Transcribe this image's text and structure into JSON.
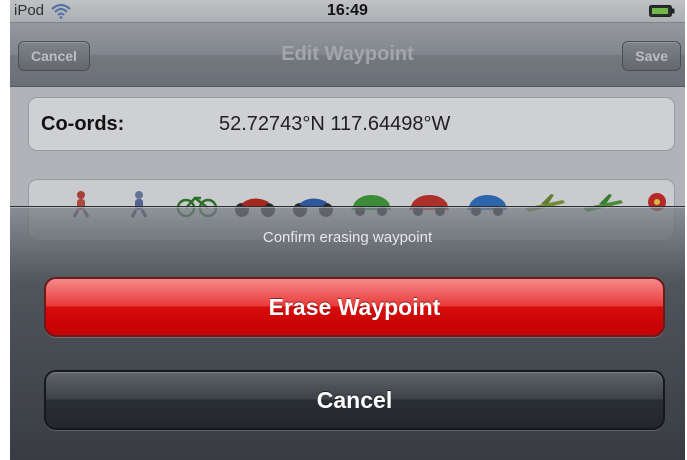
{
  "status_bar": {
    "carrier": "iPod",
    "time": "16:49",
    "wifi_icon": "wifi-icon",
    "battery_icon": "battery-icon"
  },
  "nav_bar": {
    "title": "Edit Waypoint",
    "cancel_label": "Cancel",
    "save_label": "Save"
  },
  "coords": {
    "label": "Co-ords:",
    "value": "52.72743°N 117.64498°W"
  },
  "icon_row": {
    "icons": [
      "walker-icon",
      "hiker-icon",
      "bicycle-icon",
      "motorcycle-red-icon",
      "motorcycle-blue-icon",
      "car-green-icon",
      "car-red-icon",
      "car-blue-icon",
      "plane-icon",
      "plane-green-icon",
      "flower-icon"
    ]
  },
  "action_sheet": {
    "title": "Confirm erasing waypoint",
    "erase_label": "Erase Waypoint",
    "cancel_label": "Cancel"
  },
  "colors": {
    "erase": "#d50c0c",
    "cancel": "#2a2f35"
  }
}
